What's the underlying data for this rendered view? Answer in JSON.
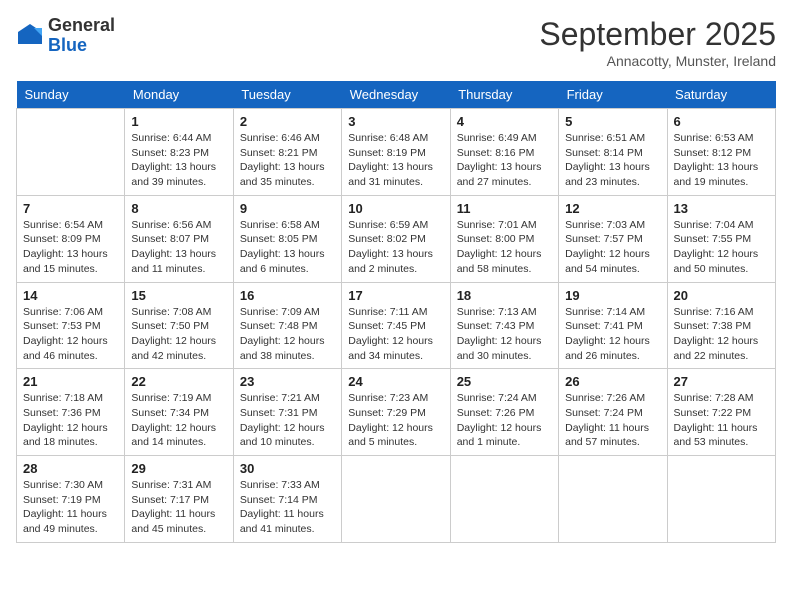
{
  "logo": {
    "line1": "General",
    "line2": "Blue"
  },
  "title": "September 2025",
  "location": "Annacotty, Munster, Ireland",
  "headers": [
    "Sunday",
    "Monday",
    "Tuesday",
    "Wednesday",
    "Thursday",
    "Friday",
    "Saturday"
  ],
  "weeks": [
    [
      {
        "day": "",
        "info": ""
      },
      {
        "day": "1",
        "info": "Sunrise: 6:44 AM\nSunset: 8:23 PM\nDaylight: 13 hours\nand 39 minutes."
      },
      {
        "day": "2",
        "info": "Sunrise: 6:46 AM\nSunset: 8:21 PM\nDaylight: 13 hours\nand 35 minutes."
      },
      {
        "day": "3",
        "info": "Sunrise: 6:48 AM\nSunset: 8:19 PM\nDaylight: 13 hours\nand 31 minutes."
      },
      {
        "day": "4",
        "info": "Sunrise: 6:49 AM\nSunset: 8:16 PM\nDaylight: 13 hours\nand 27 minutes."
      },
      {
        "day": "5",
        "info": "Sunrise: 6:51 AM\nSunset: 8:14 PM\nDaylight: 13 hours\nand 23 minutes."
      },
      {
        "day": "6",
        "info": "Sunrise: 6:53 AM\nSunset: 8:12 PM\nDaylight: 13 hours\nand 19 minutes."
      }
    ],
    [
      {
        "day": "7",
        "info": "Sunrise: 6:54 AM\nSunset: 8:09 PM\nDaylight: 13 hours\nand 15 minutes."
      },
      {
        "day": "8",
        "info": "Sunrise: 6:56 AM\nSunset: 8:07 PM\nDaylight: 13 hours\nand 11 minutes."
      },
      {
        "day": "9",
        "info": "Sunrise: 6:58 AM\nSunset: 8:05 PM\nDaylight: 13 hours\nand 6 minutes."
      },
      {
        "day": "10",
        "info": "Sunrise: 6:59 AM\nSunset: 8:02 PM\nDaylight: 13 hours\nand 2 minutes."
      },
      {
        "day": "11",
        "info": "Sunrise: 7:01 AM\nSunset: 8:00 PM\nDaylight: 12 hours\nand 58 minutes."
      },
      {
        "day": "12",
        "info": "Sunrise: 7:03 AM\nSunset: 7:57 PM\nDaylight: 12 hours\nand 54 minutes."
      },
      {
        "day": "13",
        "info": "Sunrise: 7:04 AM\nSunset: 7:55 PM\nDaylight: 12 hours\nand 50 minutes."
      }
    ],
    [
      {
        "day": "14",
        "info": "Sunrise: 7:06 AM\nSunset: 7:53 PM\nDaylight: 12 hours\nand 46 minutes."
      },
      {
        "day": "15",
        "info": "Sunrise: 7:08 AM\nSunset: 7:50 PM\nDaylight: 12 hours\nand 42 minutes."
      },
      {
        "day": "16",
        "info": "Sunrise: 7:09 AM\nSunset: 7:48 PM\nDaylight: 12 hours\nand 38 minutes."
      },
      {
        "day": "17",
        "info": "Sunrise: 7:11 AM\nSunset: 7:45 PM\nDaylight: 12 hours\nand 34 minutes."
      },
      {
        "day": "18",
        "info": "Sunrise: 7:13 AM\nSunset: 7:43 PM\nDaylight: 12 hours\nand 30 minutes."
      },
      {
        "day": "19",
        "info": "Sunrise: 7:14 AM\nSunset: 7:41 PM\nDaylight: 12 hours\nand 26 minutes."
      },
      {
        "day": "20",
        "info": "Sunrise: 7:16 AM\nSunset: 7:38 PM\nDaylight: 12 hours\nand 22 minutes."
      }
    ],
    [
      {
        "day": "21",
        "info": "Sunrise: 7:18 AM\nSunset: 7:36 PM\nDaylight: 12 hours\nand 18 minutes."
      },
      {
        "day": "22",
        "info": "Sunrise: 7:19 AM\nSunset: 7:34 PM\nDaylight: 12 hours\nand 14 minutes."
      },
      {
        "day": "23",
        "info": "Sunrise: 7:21 AM\nSunset: 7:31 PM\nDaylight: 12 hours\nand 10 minutes."
      },
      {
        "day": "24",
        "info": "Sunrise: 7:23 AM\nSunset: 7:29 PM\nDaylight: 12 hours\nand 5 minutes."
      },
      {
        "day": "25",
        "info": "Sunrise: 7:24 AM\nSunset: 7:26 PM\nDaylight: 12 hours\nand 1 minute."
      },
      {
        "day": "26",
        "info": "Sunrise: 7:26 AM\nSunset: 7:24 PM\nDaylight: 11 hours\nand 57 minutes."
      },
      {
        "day": "27",
        "info": "Sunrise: 7:28 AM\nSunset: 7:22 PM\nDaylight: 11 hours\nand 53 minutes."
      }
    ],
    [
      {
        "day": "28",
        "info": "Sunrise: 7:30 AM\nSunset: 7:19 PM\nDaylight: 11 hours\nand 49 minutes."
      },
      {
        "day": "29",
        "info": "Sunrise: 7:31 AM\nSunset: 7:17 PM\nDaylight: 11 hours\nand 45 minutes."
      },
      {
        "day": "30",
        "info": "Sunrise: 7:33 AM\nSunset: 7:14 PM\nDaylight: 11 hours\nand 41 minutes."
      },
      {
        "day": "",
        "info": ""
      },
      {
        "day": "",
        "info": ""
      },
      {
        "day": "",
        "info": ""
      },
      {
        "day": "",
        "info": ""
      }
    ]
  ]
}
